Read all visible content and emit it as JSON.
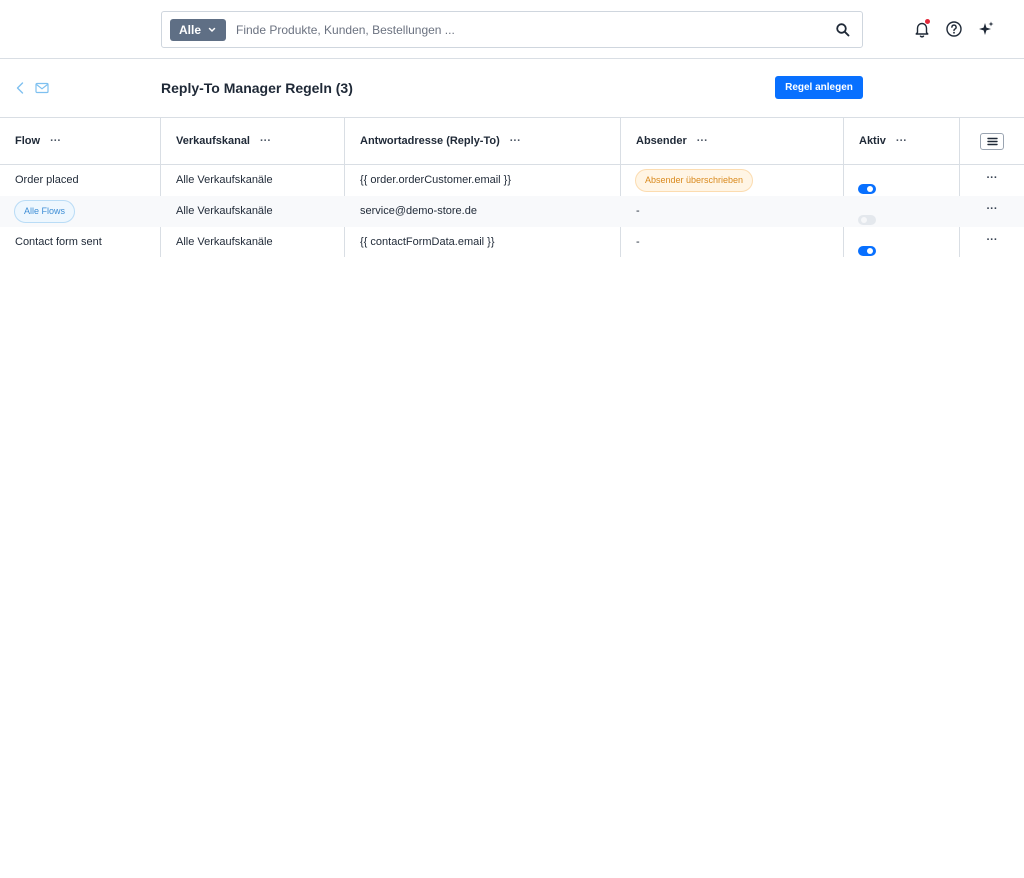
{
  "search": {
    "type_label": "Alle",
    "placeholder": "Finde Produkte, Kunden, Bestellungen ..."
  },
  "header": {
    "title": "Reply-To Manager Regeln (3)",
    "create_button": "Regel anlegen"
  },
  "table": {
    "columns": [
      {
        "label": "Flow",
        "menu": "···"
      },
      {
        "label": "Verkaufskanal",
        "menu": "···"
      },
      {
        "label": "Antwortadresse (Reply-To)",
        "menu": "···"
      },
      {
        "label": "Absender",
        "menu": "···"
      },
      {
        "label": "Aktiv",
        "menu": "···"
      }
    ],
    "rows": [
      {
        "flow": "Order placed",
        "channel": "Alle Verkaufskanäle",
        "reply_to": "{{ order.orderCustomer.email }}",
        "sender": "Absender überschrieben",
        "active": true,
        "menu": "···"
      },
      {
        "flow": "Alle Flows",
        "channel": "Alle Verkaufskanäle",
        "reply_to": "service@demo-store.de",
        "sender": "-",
        "active": false,
        "menu": "···"
      },
      {
        "flow": "Contact form sent",
        "channel": "Alle Verkaufskanäle",
        "reply_to": "{{ contactFormData.email }}",
        "sender": "-",
        "active": true,
        "menu": "···"
      }
    ]
  },
  "colors": {
    "primary": "#0870ff",
    "flow_pill": "#3d8ed6",
    "warning_pill": "#d98a1e",
    "notification_dot": "#e3283a"
  }
}
